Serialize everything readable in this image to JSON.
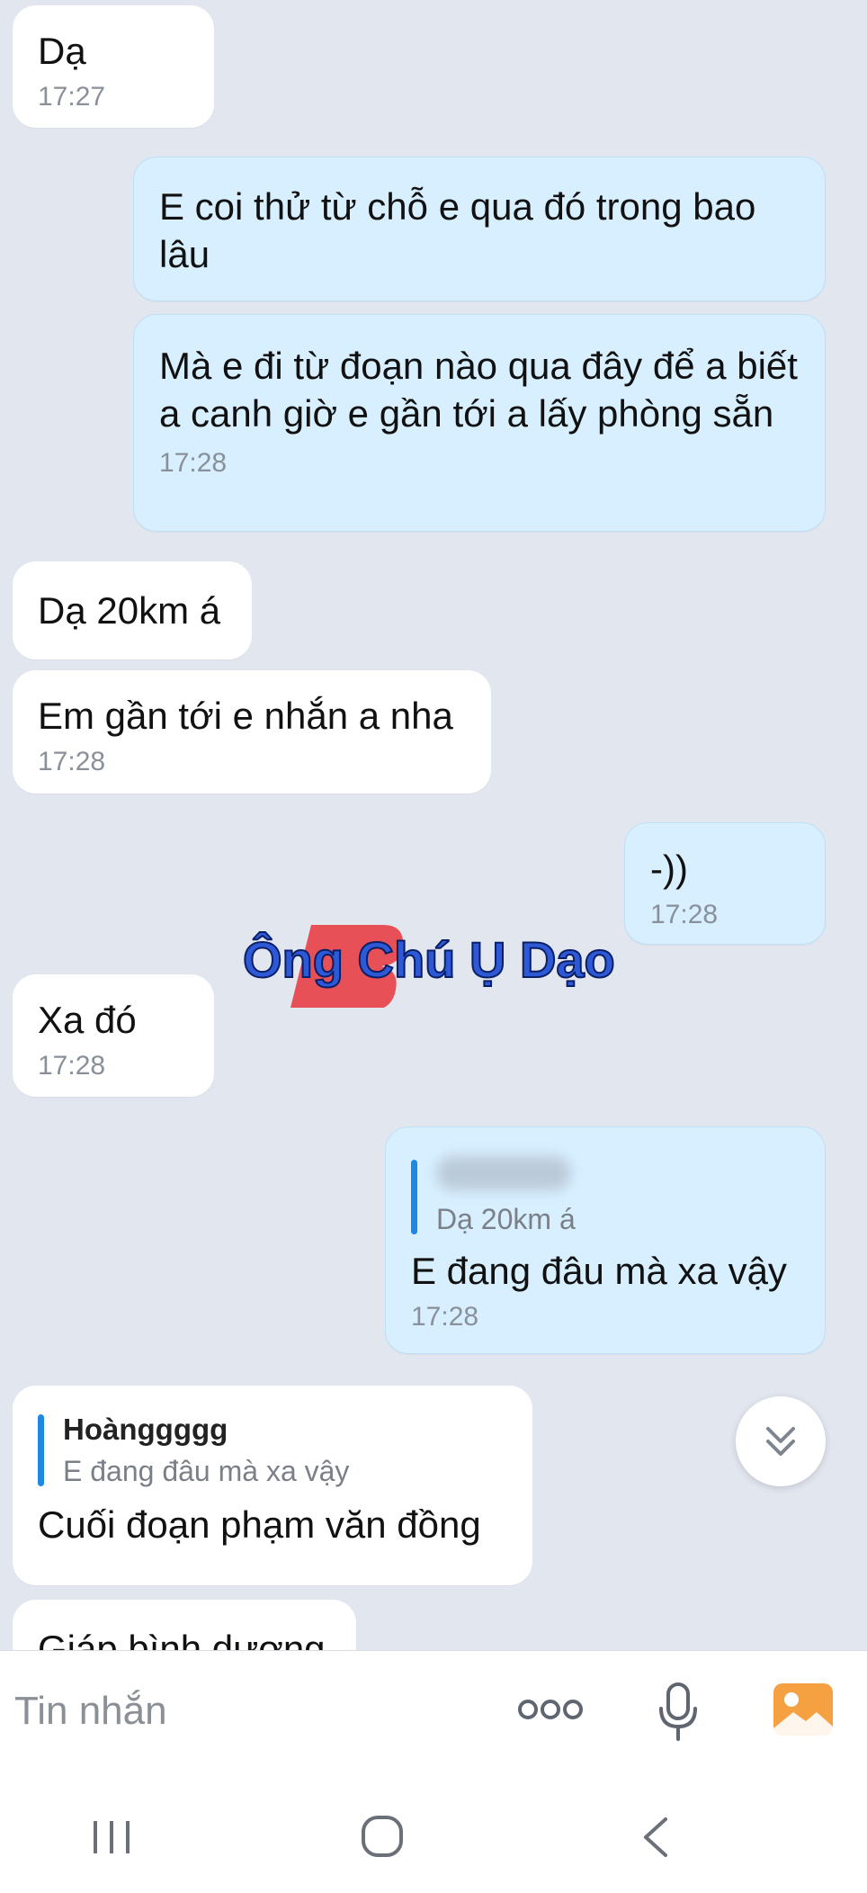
{
  "messages": [
    {
      "text": "Dạ",
      "time": "17:27"
    },
    {
      "text": "E coi thử từ chỗ e qua đó trong bao lâu"
    },
    {
      "text": "Mà e đi từ đoạn nào qua đây để a biết a canh giờ e gần tới a lấy phòng sẵn",
      "time": "17:28"
    },
    {
      "text": "Dạ 20km á"
    },
    {
      "text": "Em gần tới e nhắn a nha",
      "time": "17:28"
    },
    {
      "text": "-))",
      "time": "17:28"
    },
    {
      "text": "Xa đó",
      "time": "17:28"
    },
    {
      "quote_text": "Dạ 20km á",
      "text": "E đang đâu mà xa vậy",
      "time": "17:28"
    },
    {
      "quote_name": "Hoànggggg",
      "quote_text": "E đang đâu mà xa vậy",
      "text": "Cuối đoạn phạm văn đồng"
    },
    {
      "text": "Giáp bình dương"
    }
  ],
  "watermark": {
    "text": "Ông Chú Ụ Dạo"
  },
  "composer": {
    "placeholder": "Tin nhắn"
  },
  "icons": {
    "more": "more-dots-icon",
    "mic": "microphone-icon",
    "gallery": "image-gallery-icon",
    "scroll": "double-chevron-down-icon",
    "nav_recent": "recent-apps-icon",
    "nav_home": "home-icon",
    "nav_back": "back-icon"
  },
  "colors": {
    "background": "#e2e6ef",
    "incoming": "#ffffff",
    "outgoing": "#d7efff",
    "quote_bar": "#1e88e5",
    "gallery_icon": "#f5a142"
  }
}
